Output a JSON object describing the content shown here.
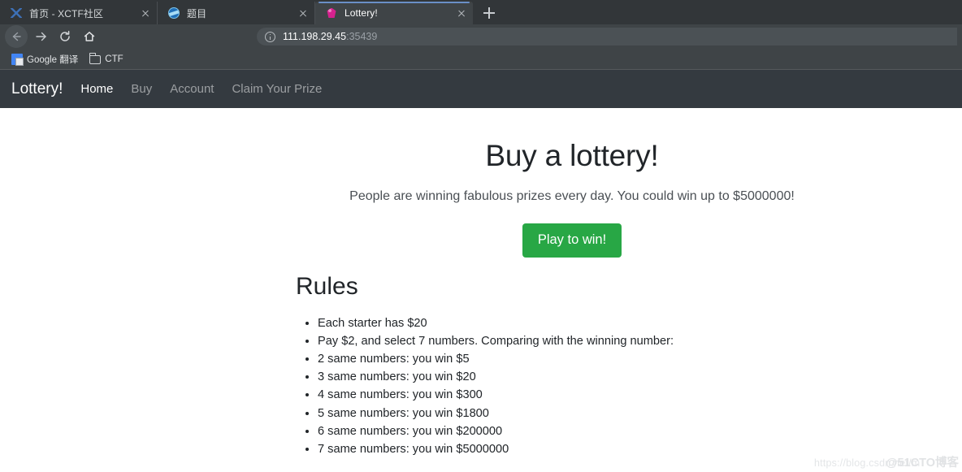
{
  "browser": {
    "tabs": [
      {
        "title": "首页 - XCTF社区",
        "favicon": "xctf-icon",
        "active": false
      },
      {
        "title": "题目",
        "favicon": "globe-icon",
        "active": false
      },
      {
        "title": "Lottery!",
        "favicon": "gem-icon",
        "active": true
      }
    ],
    "new_tab_label": "+",
    "toolbar": {
      "back_label": "Back",
      "forward_label": "Forward",
      "reload_label": "Reload",
      "home_label": "Home"
    },
    "omnibox": {
      "security_icon": "info-circle-icon",
      "host": "111.198.29.45",
      "port": ":35439"
    },
    "bookmarks": [
      {
        "label": "Google 翻译",
        "icon": "google-translate-icon"
      },
      {
        "label": "CTF",
        "icon": "folder-icon"
      }
    ]
  },
  "page": {
    "navbar": {
      "brand": "Lottery!",
      "links": [
        {
          "label": "Home",
          "active": true
        },
        {
          "label": "Buy",
          "active": false
        },
        {
          "label": "Account",
          "active": false
        },
        {
          "label": "Claim Your Prize",
          "active": false
        }
      ]
    },
    "hero": {
      "title": "Buy a lottery!",
      "subtitle": "People are winning fabulous prizes every day. You could win up to $5000000!",
      "button_label": "Play to win!"
    },
    "rules": {
      "heading": "Rules",
      "items": [
        "Each starter has $20",
        "Pay $2, and select 7 numbers. Comparing with the winning number:",
        "2 same numbers: you win $5",
        "3 same numbers: you win $20",
        "4 same numbers: you win $300",
        "5 same numbers: you win $1800",
        "6 same numbers: you win $200000",
        "7 same numbers: you win $5000000"
      ]
    },
    "watermark": {
      "url": "https://blog.csdn.net/m",
      "brand": "@51CTO博客"
    }
  },
  "colors": {
    "navbar_bg": "#343a40",
    "button_green": "#28a745",
    "chrome_dark": "#323639",
    "chrome_toolbar": "#3f4447",
    "tab_active_bg": "#3f4447",
    "tab_active_accent": "#6a8fc7"
  }
}
